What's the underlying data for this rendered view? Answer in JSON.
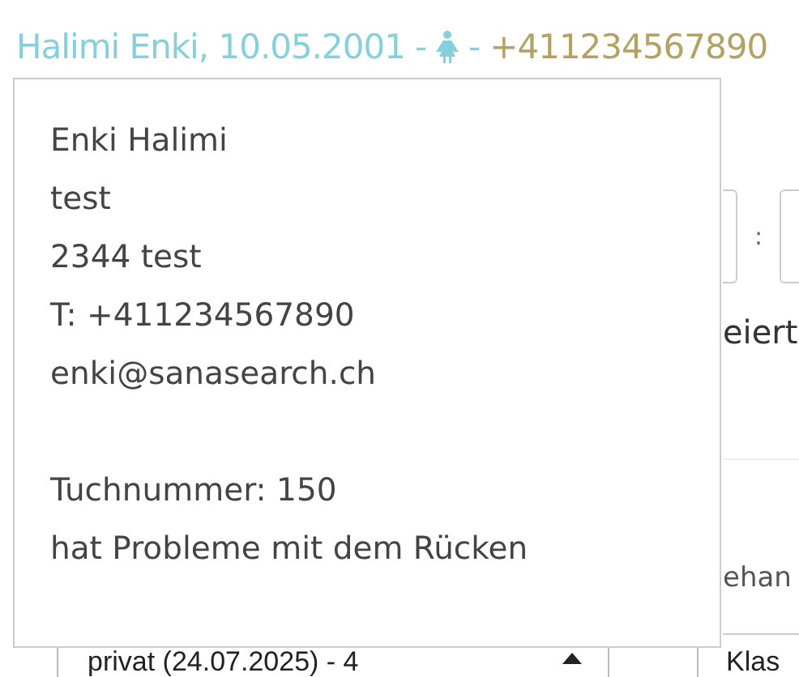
{
  "header": {
    "name_birth": "Halimi Enki, 10.05.2001",
    "separator_1": "-",
    "separator_2": "-",
    "phone": "+411234567890"
  },
  "popup": {
    "address_lines": [
      "Enki Halimi",
      "test",
      "2344 test",
      "T: +411234567890",
      "enki@sanasearch.ch"
    ],
    "notes": [
      "Tuchnummer: 150",
      "hat Probleme mit dem Rücken"
    ]
  },
  "background": {
    "time_separator": ":",
    "text_1": "eiert",
    "text_2": "ehan",
    "row": {
      "select_value": "privat (24.07.2025) - 4",
      "column_3": "Klas"
    }
  }
}
